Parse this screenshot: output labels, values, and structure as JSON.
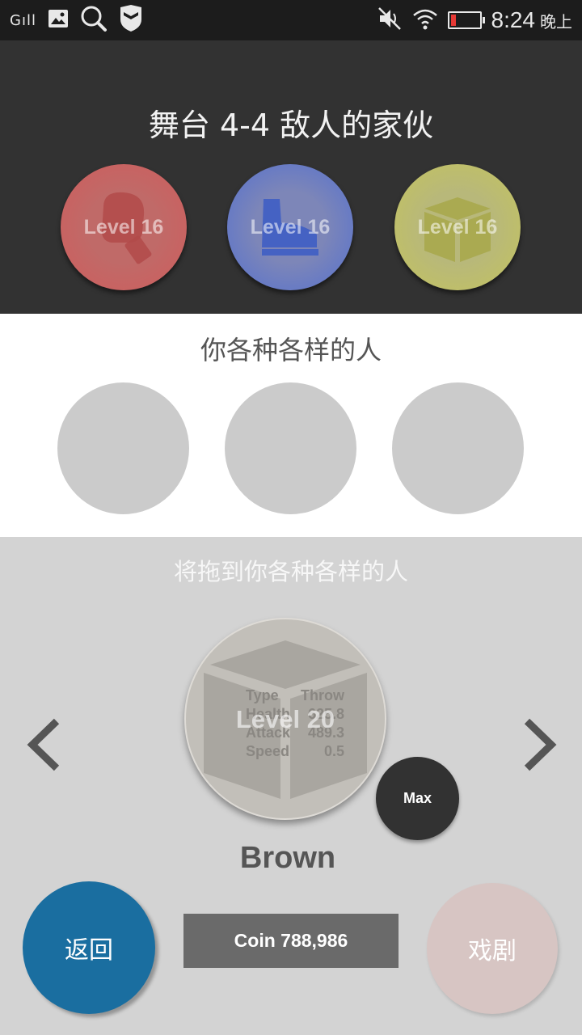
{
  "status_bar": {
    "signal_label": "G",
    "time": "8:24",
    "ampm": "晚上",
    "icons": [
      "signal-icon",
      "image-icon",
      "search-icon",
      "shield-icon",
      "mute-icon",
      "wifi-icon",
      "battery-icon"
    ],
    "battery_color": "#e53935"
  },
  "enemy_section": {
    "title": "舞台 4-4 敌人的家伙",
    "enemies": [
      {
        "level_label": "Level 16",
        "icon": "boxing-glove-icon",
        "color": "#c86464"
      },
      {
        "level_label": "Level 16",
        "icon": "shoe-icon",
        "color": "#5a78c8"
      },
      {
        "level_label": "Level 16",
        "icon": "box-icon",
        "color": "#b4b45a"
      }
    ]
  },
  "your_section": {
    "title": "你各种各样的人"
  },
  "selection": {
    "drag_hint": "将拖到你各种各样的人",
    "character": {
      "name": "Brown",
      "level_label": "Level 20",
      "icon": "box-icon",
      "stats": [
        {
          "label": "Type",
          "value": "Throw"
        },
        {
          "label": "Health",
          "value": "625.8"
        },
        {
          "label": "Attack",
          "value": "489.3"
        },
        {
          "label": "Speed",
          "value": "0.5"
        }
      ]
    },
    "max_label": "Max",
    "coin_label": "Coin 788,986",
    "back_label": "返回",
    "play_label": "戏剧"
  }
}
